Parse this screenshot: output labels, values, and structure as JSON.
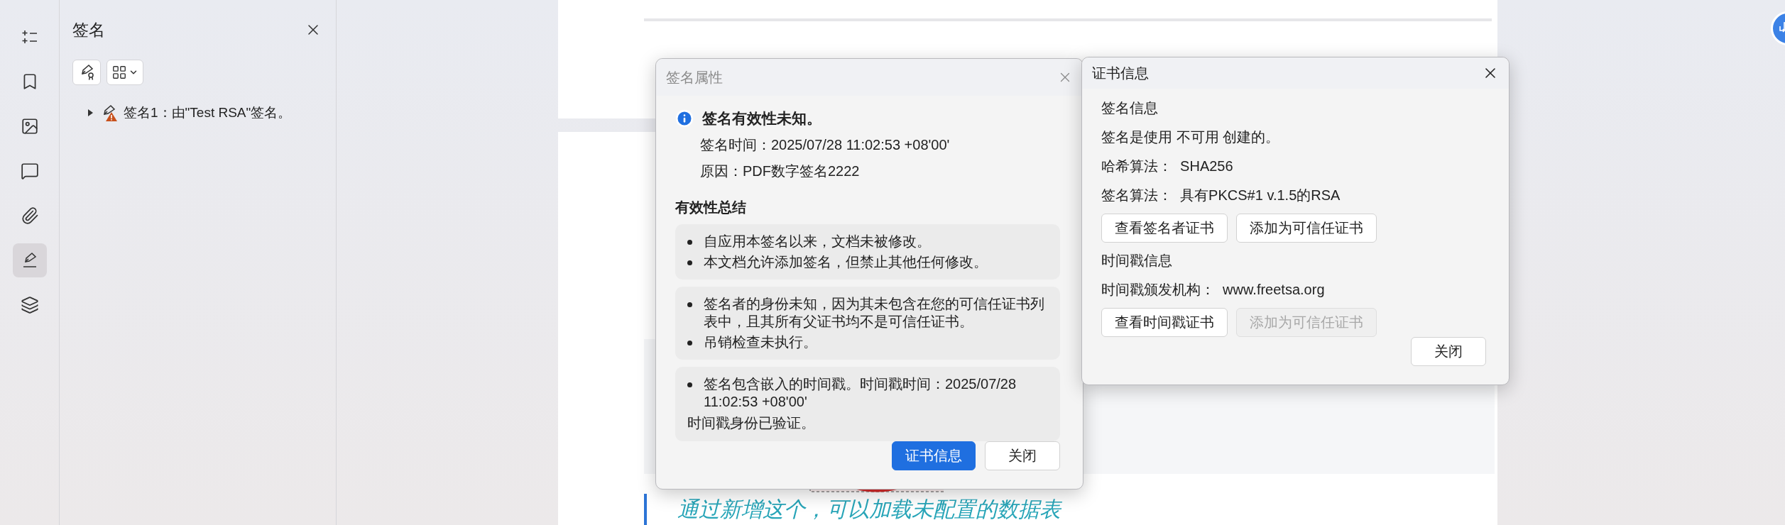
{
  "icon_rail": {
    "items": [
      {
        "kind": "outline",
        "selected": false
      },
      {
        "kind": "bookmark",
        "selected": false
      },
      {
        "kind": "image",
        "selected": false
      },
      {
        "kind": "comment",
        "selected": false
      },
      {
        "kind": "attachment",
        "selected": false
      },
      {
        "kind": "signature",
        "selected": true
      },
      {
        "kind": "layers",
        "selected": false
      }
    ]
  },
  "sidebar": {
    "title": "签名",
    "tree": [
      {
        "label": "签名1：由\"Test RSA\"签名。",
        "expanded": false,
        "warning": true
      }
    ]
  },
  "document": {
    "quote": "通过新增这个，可以加载未配置的数据表"
  },
  "signature_properties_dialog": {
    "title": "签名属性",
    "active": false,
    "status": "签名有效性未知。",
    "details": [
      "签名时间：2025/07/28 11:02:53 +08'00'",
      "原因：PDF数字签名2222"
    ],
    "summary_title": "有效性总结",
    "summary_groups": [
      {
        "bullets": [
          "自应用本签名以来，文档未被修改。",
          "本文档允许添加签名，但禁止其他任何修改。"
        ]
      },
      {
        "bullets": [
          "签名者的身份未知，因为其未包含在您的可信任证书列表中，且其所有父证书均不是可信任证书。",
          "吊销检查未执行。"
        ]
      },
      {
        "bullets": [
          "签名包含嵌入的时间戳。时间戳时间：2025/07/28 11:02:53 +08'00'"
        ],
        "note": "时间戳身份已验证。"
      }
    ],
    "buttons": [
      {
        "label": "证书信息",
        "primary": true
      },
      {
        "label": "关闭",
        "primary": false
      }
    ]
  },
  "certificate_dialog": {
    "title": "证书信息",
    "active": true,
    "sections": [
      {
        "title": "签名信息",
        "lines": [
          {
            "label": "签名是使用 不可用 创建的。"
          },
          {
            "label": "哈希算法：",
            "value": "SHA256"
          },
          {
            "label": "签名算法：",
            "value": "具有PKCS#1 v.1.5的RSA"
          }
        ],
        "buttons": [
          {
            "label": "查看签名者证书",
            "disabled": false
          },
          {
            "label": "添加为可信任证书",
            "disabled": false
          }
        ]
      },
      {
        "title": "时间戳信息",
        "lines": [
          {
            "label": "时间戳颁发机构：",
            "value": "www.freetsa.org"
          }
        ],
        "buttons": [
          {
            "label": "查看时间戳证书",
            "disabled": false
          },
          {
            "label": "添加为可信任证书",
            "disabled": true
          }
        ]
      }
    ],
    "close_button": "关闭"
  }
}
